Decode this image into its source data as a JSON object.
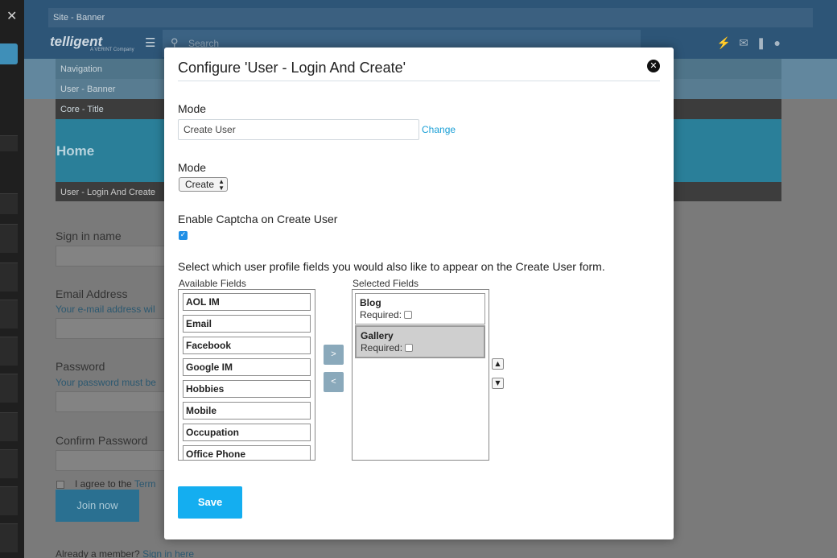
{
  "background": {
    "site_banner": "Site - Banner",
    "logo": "telligent",
    "logo_sub": "A VERINT Company",
    "search_placeholder": "Search",
    "navigation": "Navigation",
    "user_banner": "User - Banner",
    "core_title": "Core - Title",
    "home": "Home",
    "login_widget": "User - Login And Create",
    "sign_in_name": "Sign in name",
    "email_label": "Email Address",
    "email_hint": "Your e-mail address wil",
    "password_label": "Password",
    "password_hint": "Your password must be",
    "confirm_label": "Confirm Password",
    "agree_text": "I agree to the",
    "terms_link": "Term",
    "join_button": "Join now",
    "already_member": "Already a member?",
    "sign_in_link": "Sign in here"
  },
  "modal": {
    "title": "Configure 'User - Login And Create'",
    "mode_label_1": "Mode",
    "mode_value": "Create User",
    "change_link": "Change",
    "mode_label_2": "Mode",
    "mode_select_value": "Create",
    "captcha_label": "Enable Captcha on Create User",
    "captcha_checked": true,
    "profile_prompt": "Select which user profile fields you would also like to appear on the Create User form.",
    "available_label": "Available Fields",
    "selected_label": "Selected Fields",
    "available_fields": [
      "AOL IM",
      "Email",
      "Facebook",
      "Google IM",
      "Hobbies",
      "Mobile",
      "Occupation",
      "Office Phone"
    ],
    "selected_fields": [
      {
        "name": "Blog",
        "required_label": "Required:"
      },
      {
        "name": "Gallery",
        "required_label": "Required:"
      }
    ],
    "move_right": ">",
    "move_left": "<",
    "move_up": "▲",
    "move_down": "▼",
    "save_button": "Save"
  },
  "colors": {
    "accent": "#14aef0",
    "link": "#1a9fd6",
    "checkbox": "#1f8fe6"
  }
}
